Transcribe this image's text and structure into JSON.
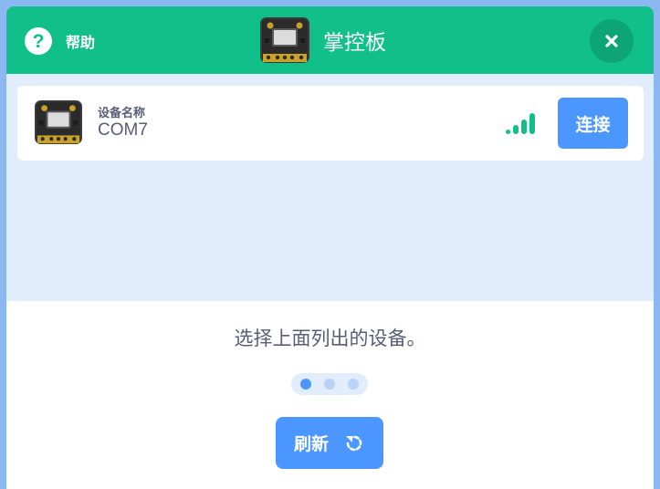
{
  "header": {
    "help_label": "帮助",
    "title": "掌控板",
    "background_color": "#11bf89",
    "help_icon": "question-circle-icon",
    "close_icon": "close-x-icon",
    "board_icon": "mpython-board-icon"
  },
  "devices": [
    {
      "caption": "设备名称",
      "name": "COM7",
      "signal_icon": "signal-strength-icon",
      "connect_label": "连接"
    }
  ],
  "footer": {
    "instruction": "选择上面列出的设备。",
    "refresh_label": "刷新",
    "refresh_icon": "refresh-icon",
    "accent_color": "#4c97ff"
  }
}
